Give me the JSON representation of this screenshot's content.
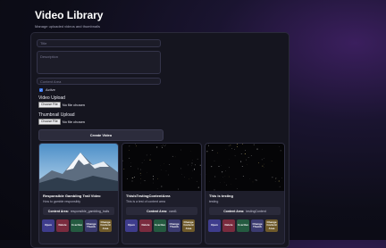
{
  "header": {
    "title": "Video Library",
    "subtitle": "Manage uploaded videos and thumbnails"
  },
  "form": {
    "title_placeholder": "Title",
    "description_placeholder": "Description",
    "content_placeholder": "Content Area",
    "active_label": "Active",
    "active_checked": true,
    "video_upload_label": "Video Upload",
    "thumbnail_upload_label": "Thumbnail Upload",
    "choose_file_label": "Choose File",
    "no_file_label": "No file chosen",
    "create_button_label": "Create Video"
  },
  "cards": [
    {
      "title": "Responsible Gambling Trail Video",
      "description": "How to gamble responsibly",
      "content_label": "Content Area:",
      "content_value": "responsible_gambling_trails",
      "thumbnail": "mountain-photo",
      "actions": [
        "Open",
        "Delete",
        "In active",
        "Change Thumb",
        "Change Content Area"
      ]
    },
    {
      "title": "ThisIsTestingContentArea",
      "description": "This is a test of content area",
      "content_label": "Content Area:",
      "content_value": "card1",
      "thumbnail": "starfield",
      "actions": [
        "Open",
        "Delete",
        "In active",
        "Change Thumb",
        "Change Content Area"
      ]
    },
    {
      "title": "This is testing",
      "description": "testing",
      "content_label": "Content Area:",
      "content_value": "testingContent",
      "thumbnail": "starfield",
      "actions": [
        "Open",
        "Delete",
        "In active",
        "Change Thumb",
        "Change Content Area"
      ]
    }
  ],
  "colors": {
    "accent": "#3d7bf5",
    "open": "#3e3c8c",
    "delete": "#7a2b3e",
    "toggle": "#245a40",
    "change_thumb": "#3b3b70",
    "change_content": "#6f5a2a"
  }
}
